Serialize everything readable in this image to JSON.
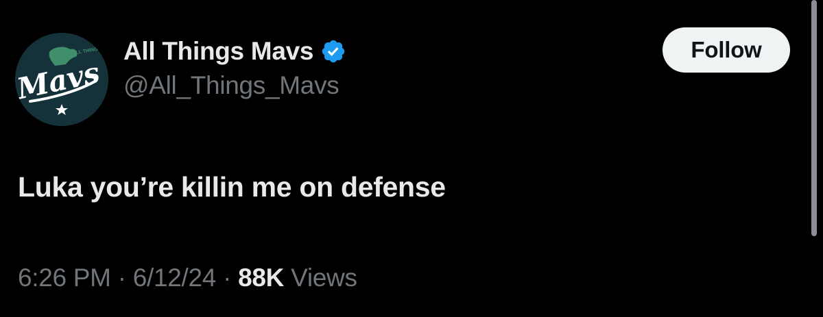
{
  "tweet": {
    "author": {
      "display_name": "All Things Mavs",
      "handle": "@All_Things_Mavs",
      "verified": true,
      "verified_icon": "verified-badge-icon",
      "avatar_logo_text": "Mavs",
      "avatar_logo_small_text": "ALL THINGS"
    },
    "follow_label": "Follow",
    "text": "Luka you’re killin me on defense",
    "time": "6:26 PM",
    "separator": "·",
    "date": "6/12/24",
    "views_count": "88K",
    "views_label": "Views"
  },
  "colors": {
    "background": "#000000",
    "primary_text": "#e7e9ea",
    "secondary_text": "#71767b",
    "verified_blue": "#1d9bf0",
    "follow_bg": "#eff3f4",
    "follow_text": "#0f1419",
    "avatar_bg": "#15323a",
    "avatar_green": "#3f8f6a"
  }
}
